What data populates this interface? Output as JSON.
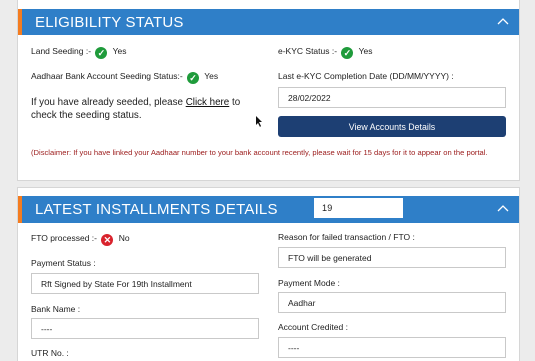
{
  "eligibility": {
    "title": "ELIGIBILITY STATUS",
    "land_seeding_label": "Land Seeding :-",
    "land_seeding_value": "Yes",
    "ekyc_status_label": "e-KYC Status :-",
    "ekyc_status_value": "Yes",
    "aadhaar_seeding_label": "Aadhaar Bank Account Seeding Status:-",
    "aadhaar_seeding_value": "Yes",
    "seeded_text_before": "If you have already seeded, please ",
    "seeded_link": "Click here",
    "seeded_text_after": " to check the seeding status.",
    "last_ekyc_label": "Last e-KYC Completion Date (DD/MM/YYYY) :",
    "last_ekyc_value": "28/02/2022",
    "view_accounts_button": "View Accounts Details",
    "disclaimer": "(Disclaimer: If you have linked your Aadhaar number to your bank account recently, please wait for 15 days for it to appear on the portal."
  },
  "installments": {
    "title": "LATEST INSTALLMENTS DETAILS",
    "installment_number": "19",
    "fto_processed_label": "FTO processed :-",
    "fto_processed_value": "No",
    "reason_failed_label": "Reason for failed transaction / FTO :",
    "reason_failed_value": "FTO will be generated",
    "payment_status_label": "Payment Status :",
    "payment_status_value": "Rft Signed by State For 19th Installment",
    "payment_mode_label": "Payment Mode :",
    "payment_mode_value": "Aadhar",
    "bank_name_label": "Bank Name :",
    "bank_name_value": "----",
    "account_credited_label": "Account Credited :",
    "account_credited_value": "----",
    "utr_label": "UTR No. :"
  },
  "colors": {
    "header_blue": "#2f7fc8",
    "header_accent": "#f47c20",
    "button_navy": "#1d3f73",
    "disclaimer_red": "#9b1b1b",
    "check_green": "#1f9b3b",
    "cross_red": "#d9232d"
  },
  "icons": {
    "check": "check-circle-icon",
    "cross": "cross-circle-icon",
    "collapse": "chevron-up-icon"
  }
}
